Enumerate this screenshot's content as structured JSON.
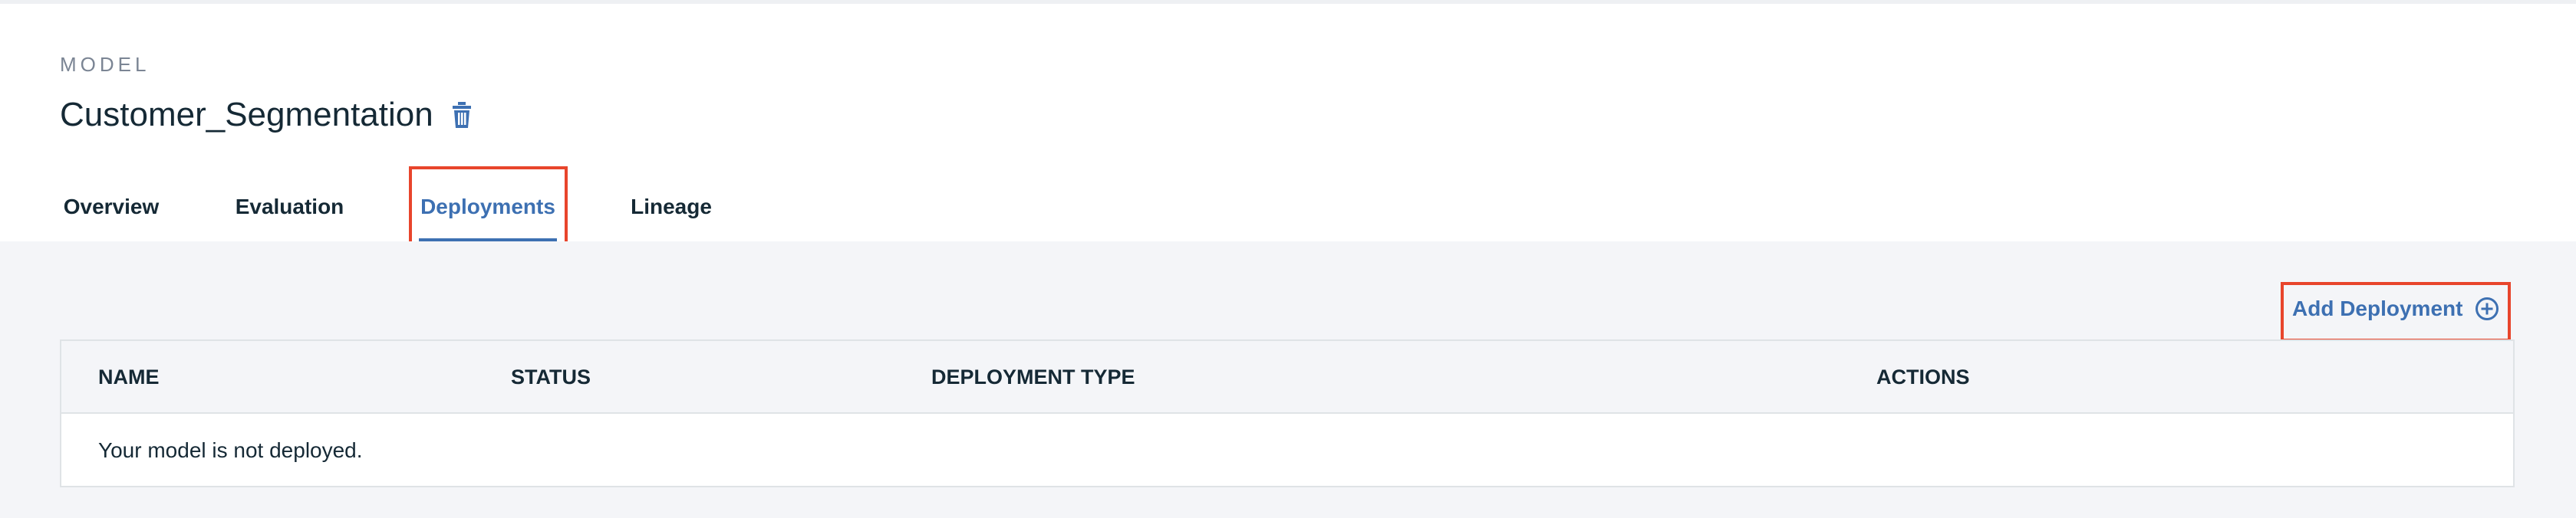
{
  "header": {
    "eyebrow": "MODEL",
    "title": "Customer_Segmentation",
    "delete_icon": "trash-icon"
  },
  "tabs": [
    {
      "label": "Overview",
      "active": false
    },
    {
      "label": "Evaluation",
      "active": false
    },
    {
      "label": "Deployments",
      "active": true
    },
    {
      "label": "Lineage",
      "active": false
    }
  ],
  "toolbar": {
    "add_label": "Add Deployment",
    "add_icon": "plus-circle-icon"
  },
  "table": {
    "columns": [
      "NAME",
      "STATUS",
      "DEPLOYMENT TYPE",
      "ACTIONS"
    ],
    "empty_message": "Your model is not deployed."
  },
  "colors": {
    "accent": "#3d70b2",
    "highlight": "#e8452c",
    "text": "#152935",
    "muted": "#7b8594",
    "background": "#f4f5f8"
  }
}
